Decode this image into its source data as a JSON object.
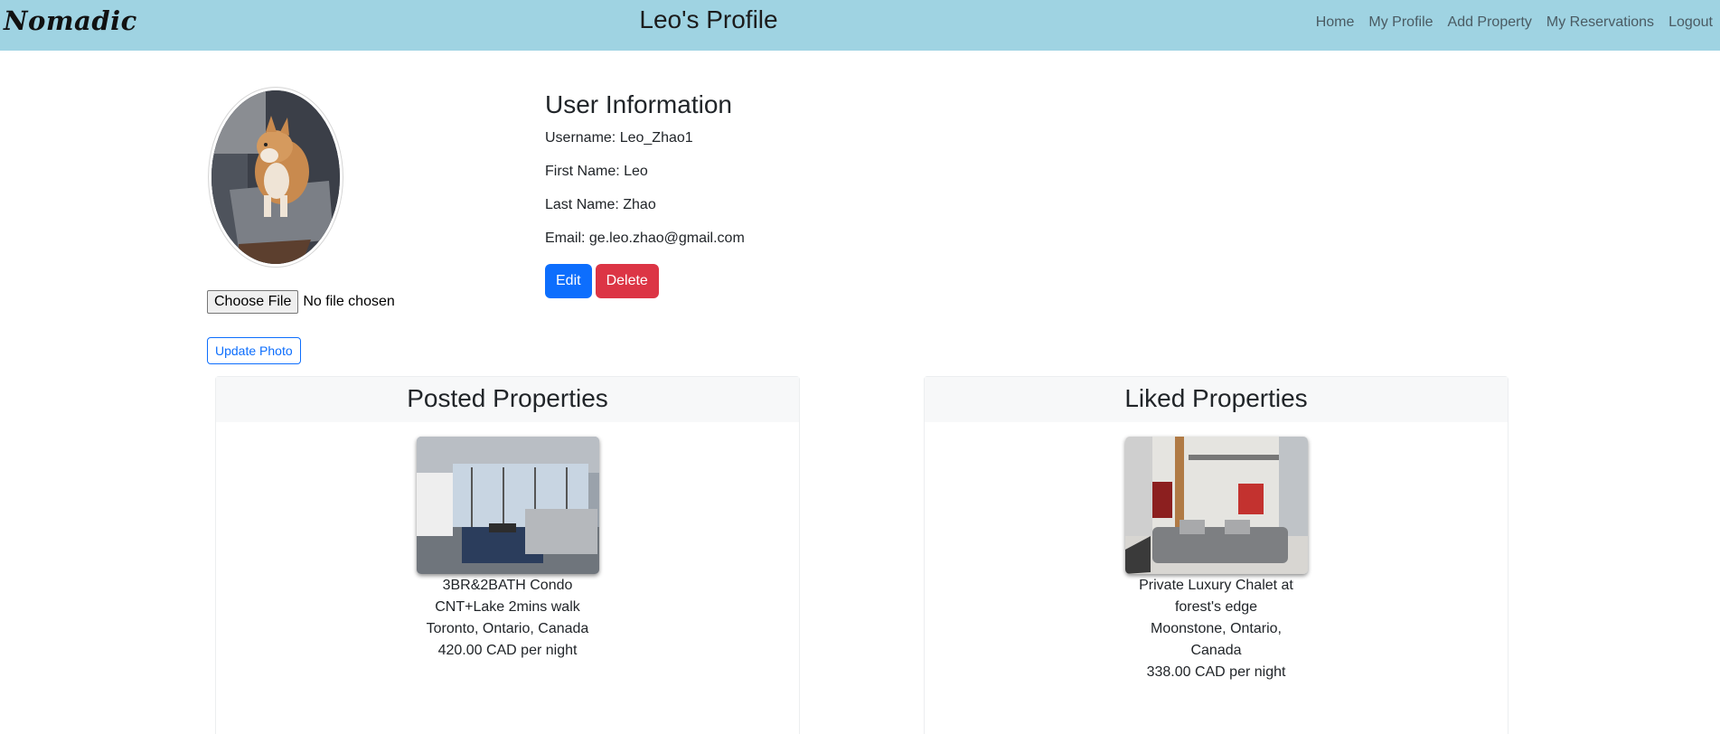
{
  "nav": {
    "brand": "Nomadic",
    "title": "Leo's Profile",
    "links": [
      "Home",
      "My Profile",
      "Add Property",
      "My Reservations",
      "Logout"
    ]
  },
  "photo": {
    "choose_file_label": "Choose File",
    "file_status": "No file chosen",
    "update_label": "Update Photo"
  },
  "user": {
    "heading": "User Information",
    "username": "Username: Leo_Zhao1",
    "first_name": "First Name: Leo",
    "last_name": "Last Name: Zhao",
    "email": "Email: ge.leo.zhao@gmail.com",
    "edit_label": "Edit",
    "delete_label": "Delete"
  },
  "posted": {
    "heading": "Posted Properties",
    "property": {
      "title": "3BR&2BATH Condo CNT+Lake 2mins walk",
      "location": "Toronto, Ontario, Canada",
      "price": "420.00 CAD per night"
    }
  },
  "liked": {
    "heading": "Liked Properties",
    "property": {
      "title": "Private Luxury Chalet at forest's edge",
      "location": "Moonstone, Ontario, Canada",
      "price": "338.00 CAD per night"
    }
  },
  "colors": {
    "navbar": "#9fd3e2",
    "primary": "#0d6efd",
    "danger": "#dc3545"
  }
}
